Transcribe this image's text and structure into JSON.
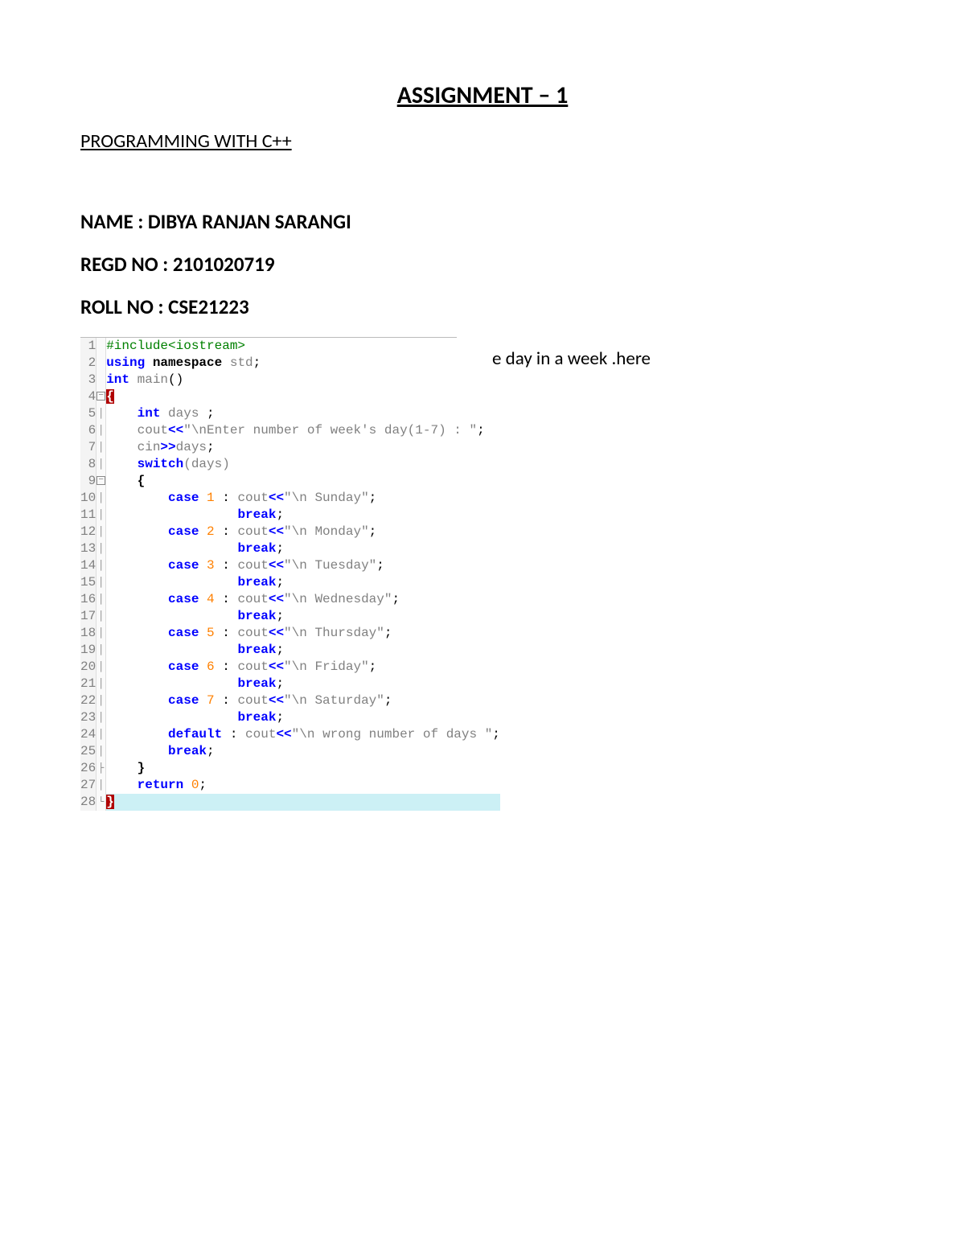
{
  "title": "ASSIGNMENT – 1",
  "subtitle": "PROGRAMMING WITH C++",
  "name_line": "NAME : DIBYA RANJAN SARANGI",
  "regd_line": "REGD NO : 2101020719",
  "roll_line": "ROLL NO : CSE21223",
  "side_text": "e day in a week .here",
  "code": {
    "l1_include": "#include<iostream>",
    "l2_using": "using",
    "l2_namespace": " namespace",
    "l2_std": " std",
    "l2_semi": ";",
    "l3_int": "int",
    "l3_main": " main",
    "l3_paren": "()",
    "l4_brace": "{",
    "l5_int": "int",
    "l5_days": " days ",
    "l5_semi": ";",
    "l6_cout": "cout",
    "l6_op1": "<<",
    "l6_str": "\"\\nEnter number of week's day(1-7) : \"",
    "l6_semi": ";",
    "l7_cin": "cin",
    "l7_op": ">>",
    "l7_days": "days",
    "l7_semi": ";",
    "l8_switch": "switch",
    "l8_days": "(days)",
    "l9_brace": "{",
    "l10_case": "case",
    "l10_num": " 1 ",
    "l10_colon": ": ",
    "l10_cout": "cout",
    "l10_op": "<<",
    "l10_str": "\"\\n Sunday\"",
    "l10_semi": ";",
    "l11_break": "break",
    "l11_semi": ";",
    "l12_case": "case",
    "l12_num": " 2 ",
    "l12_colon": ": ",
    "l12_cout": "cout",
    "l12_op": "<<",
    "l12_str": "\"\\n Monday\"",
    "l12_semi": ";",
    "l13_break": "break",
    "l13_semi": ";",
    "l14_case": "case",
    "l14_num": " 3 ",
    "l14_colon": ": ",
    "l14_cout": "cout",
    "l14_op": "<<",
    "l14_str": "\"\\n Tuesday\"",
    "l14_semi": ";",
    "l15_break": "break",
    "l15_semi": ";",
    "l16_case": "case",
    "l16_num": " 4 ",
    "l16_colon": ": ",
    "l16_cout": "cout",
    "l16_op": "<<",
    "l16_str": "\"\\n Wednesday\"",
    "l16_semi": ";",
    "l17_break": "break",
    "l17_semi": ";",
    "l18_case": "case",
    "l18_num": " 5 ",
    "l18_colon": ": ",
    "l18_cout": "cout",
    "l18_op": "<<",
    "l18_str": "\"\\n Thursday\"",
    "l18_semi": ";",
    "l19_break": "break",
    "l19_semi": ";",
    "l20_case": "case",
    "l20_num": " 6 ",
    "l20_colon": ": ",
    "l20_cout": "cout",
    "l20_op": "<<",
    "l20_str": "\"\\n Friday\"",
    "l20_semi": ";",
    "l21_break": "break",
    "l21_semi": ";",
    "l22_case": "case",
    "l22_num": " 7 ",
    "l22_colon": ": ",
    "l22_cout": "cout",
    "l22_op": "<<",
    "l22_str": "\"\\n Saturday\"",
    "l22_semi": ";",
    "l23_break": "break",
    "l23_semi": ";",
    "l24_default": "default",
    "l24_colon": " : ",
    "l24_cout": "cout",
    "l24_op": "<<",
    "l24_str": "\"\\n wrong number of days \"",
    "l24_semi": ";",
    "l25_break": "break",
    "l25_semi": ";",
    "l26_brace": "}",
    "l27_return": "return",
    "l27_num": " 0",
    "l27_semi": ";",
    "l28_brace": "}",
    "lines": [
      "1",
      "2",
      "3",
      "4",
      "5",
      "6",
      "7",
      "8",
      "9",
      "10",
      "11",
      "12",
      "13",
      "14",
      "15",
      "16",
      "17",
      "18",
      "19",
      "20",
      "21",
      "22",
      "23",
      "24",
      "25",
      "26",
      "27",
      "28"
    ]
  }
}
